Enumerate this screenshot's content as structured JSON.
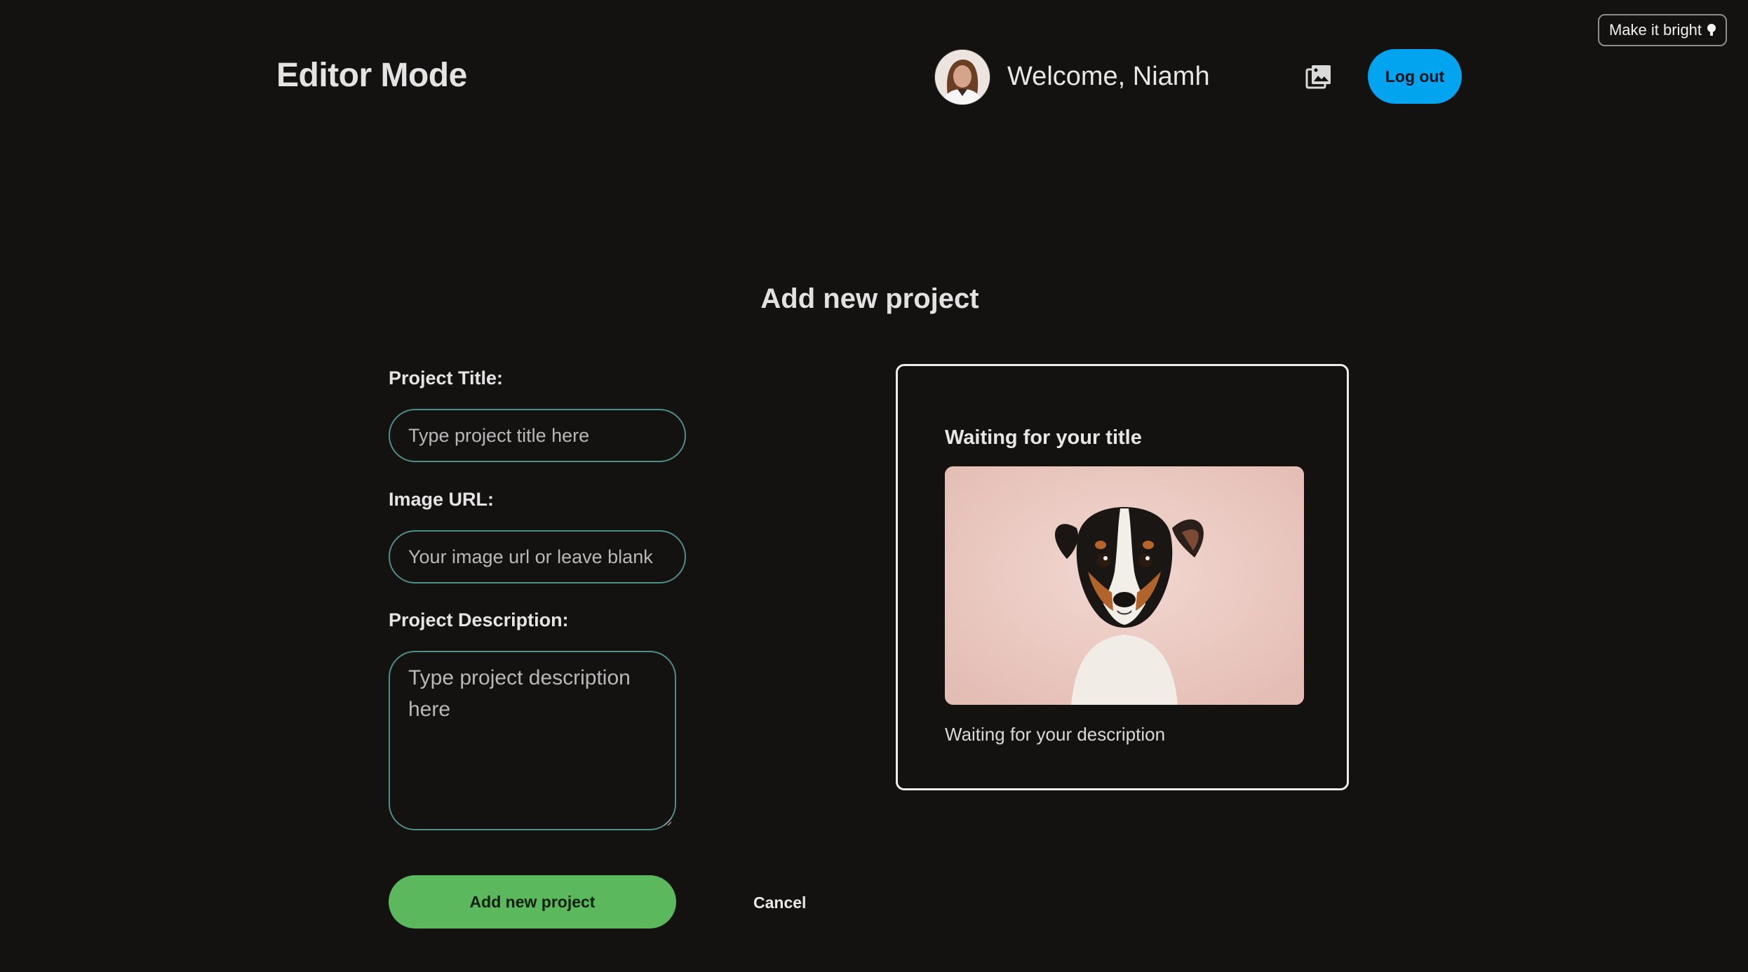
{
  "theme_toggle": {
    "label": "Make it bright",
    "icon": "lightbulb-icon"
  },
  "header": {
    "brand": "Editor Mode",
    "welcome": "Welcome, Niamh",
    "gallery_icon": "image-gallery-icon",
    "logout_label": "Log out",
    "logout_color": "#03a4ef"
  },
  "page_title": "Add new project",
  "form": {
    "title_label": "Project Title:",
    "title_placeholder": "Type project title here",
    "image_label": "Image URL:",
    "image_placeholder": "Your image url or leave blank",
    "description_label": "Project Description:",
    "description_placeholder": "Type project description here",
    "submit_label": "Add new project",
    "submit_color": "#5cb85c",
    "cancel_label": "Cancel"
  },
  "preview": {
    "title": "Waiting for your title",
    "description": "Waiting for your description",
    "image": "dog-photo"
  }
}
